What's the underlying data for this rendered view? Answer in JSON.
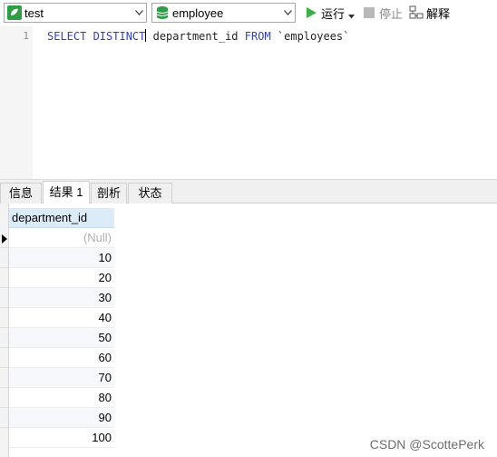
{
  "toolbar": {
    "connection": "test",
    "database": "employee",
    "run_label": "运行",
    "stop_label": "停止",
    "explain_label": "解释"
  },
  "editor": {
    "line_number": "1",
    "kw1": "SELECT DISTINCT",
    "col": "department_id",
    "kw2": "FROM",
    "table": "`employees`"
  },
  "tabs": [
    "信息",
    "结果 1",
    "剖析",
    "状态"
  ],
  "active_tab": "结果 1",
  "grid": {
    "column": "department_id",
    "rows": [
      "(Null)",
      "10",
      "20",
      "30",
      "40",
      "50",
      "60",
      "70",
      "80",
      "90",
      "100"
    ]
  },
  "watermark": "CSDN @ScottePerk",
  "colors": {
    "run_green": "#3cb043",
    "db_green": "#2e9e44",
    "keyword_blue": "#2f3fd0",
    "header_blue": "#dcebf8"
  }
}
